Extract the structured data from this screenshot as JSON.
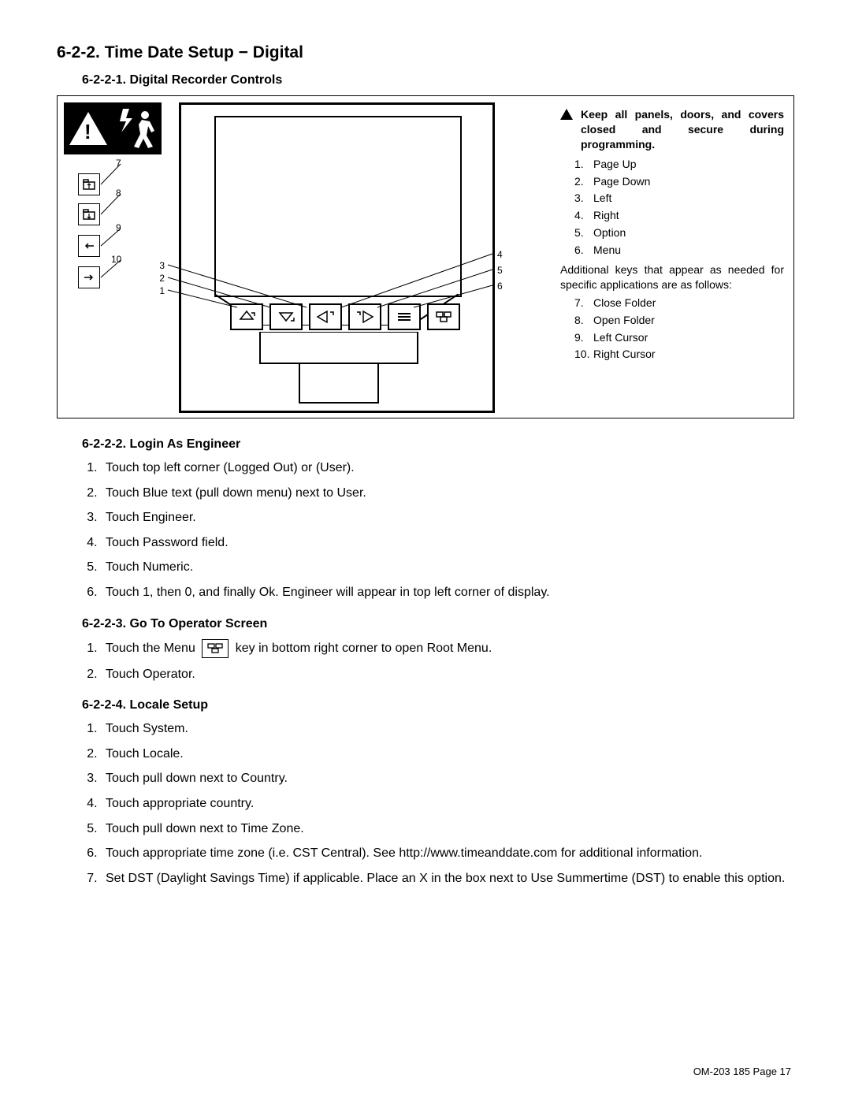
{
  "headings": {
    "main": "6-2-2.   Time Date Setup − Digital",
    "sub1": "6-2-2-1.  Digital Recorder Controls",
    "sub2": "6-2-2-2.  Login As Engineer",
    "sub3": "6-2-2-3.  Go To Operator Screen",
    "sub4": "6-2-2-4.  Locale Setup"
  },
  "legend": {
    "warning": "Keep all panels, doors, and covers closed and secure during programming.",
    "items": [
      {
        "n": "1.",
        "t": "Page Up"
      },
      {
        "n": "2.",
        "t": "Page Down"
      },
      {
        "n": "3.",
        "t": "Left"
      },
      {
        "n": "4.",
        "t": "Right"
      },
      {
        "n": "5.",
        "t": "Option"
      },
      {
        "n": "6.",
        "t": "Menu"
      }
    ],
    "additional": "Additional keys that appear as needed for specific applications are as follows:",
    "extra": [
      {
        "n": "7.",
        "t": "Close Folder"
      },
      {
        "n": "8.",
        "t": "Open Folder"
      },
      {
        "n": "9.",
        "t": "Left Cursor"
      },
      {
        "n": "10.",
        "t": "Right Cursor"
      }
    ]
  },
  "sideNums": {
    "n7": "7",
    "n8": "8",
    "n9": "9",
    "n10": "10"
  },
  "calloutL": {
    "n1": "1",
    "n2": "2",
    "n3": "3"
  },
  "calloutR": {
    "n4": "4",
    "n5": "5",
    "n6": "6"
  },
  "loginSteps": [
    "Touch top left corner (Logged Out) or (User).",
    "Touch Blue text (pull down menu) next to User.",
    "Touch Engineer.",
    "Touch Password field.",
    "Touch Numeric.",
    "Touch 1, then 0, and finally Ok.  Engineer  will appear in top left corner of display."
  ],
  "gotoOperator": {
    "s1a": "Touch the Menu",
    "s1b": "key in bottom right corner to open Root Menu.",
    "s2": "Touch Operator."
  },
  "localeSteps": [
    "Touch System.",
    "Touch Locale.",
    "Touch pull down next to Country.",
    "Touch appropriate country.",
    "Touch pull down next to Time Zone.",
    "Touch appropriate time zone (i.e. CST Central). See  http://www.timeanddate.com  for additional information.",
    "Set DST (Daylight Savings Time) if applicable. Place an  X  in the box next to  Use Summertime (DST)  to enable this option."
  ],
  "footer": "OM-203 185 Page 17"
}
